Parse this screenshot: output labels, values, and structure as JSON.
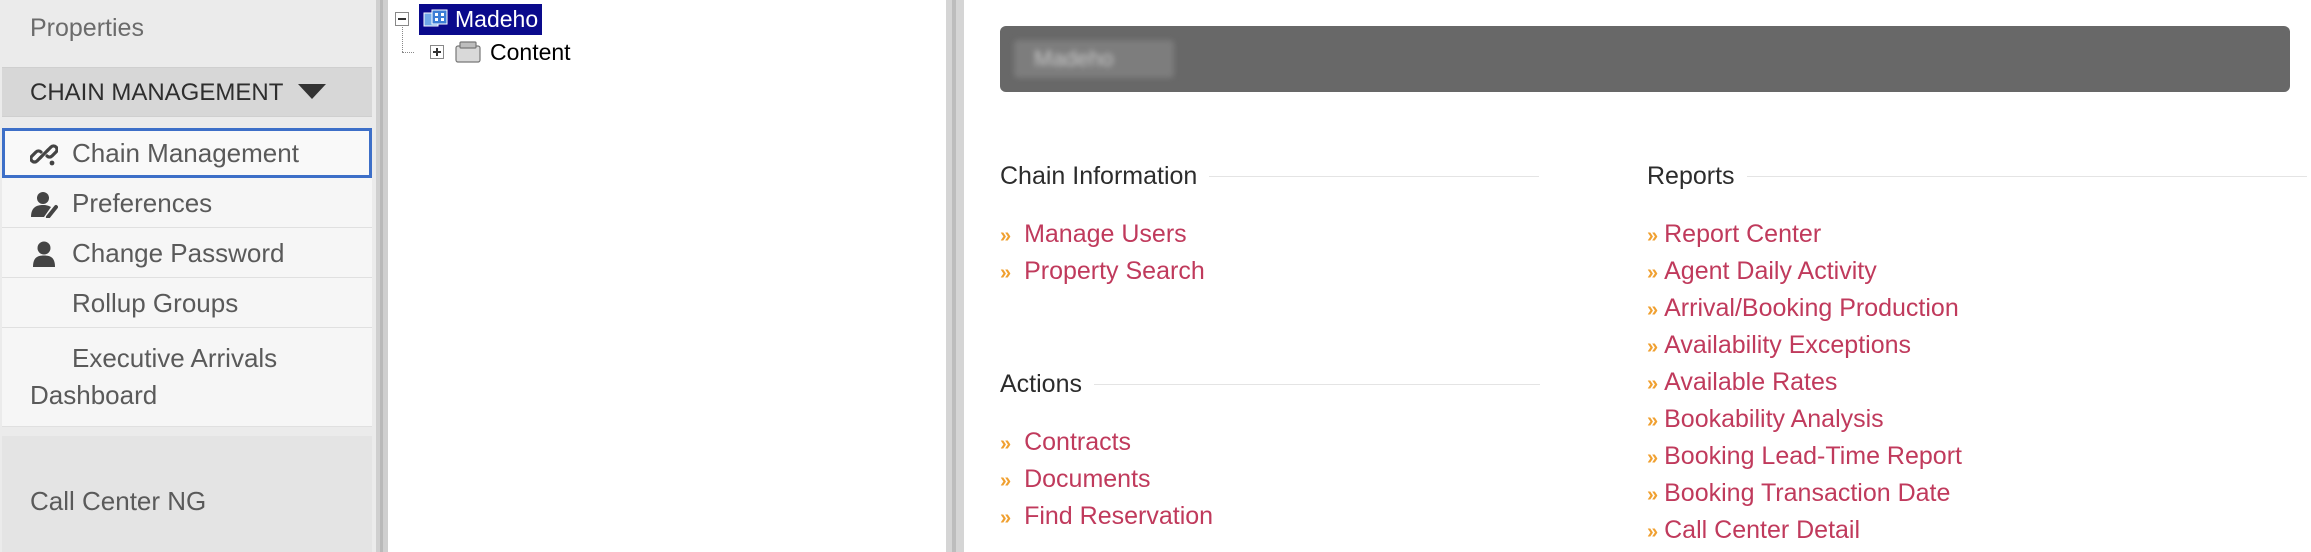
{
  "sidebar": {
    "top_label": "Properties",
    "section_header": "CHAIN MANAGEMENT",
    "items": [
      {
        "label": "Chain Management",
        "icon": "link-icon",
        "active": true
      },
      {
        "label": "Preferences",
        "icon": "user-settings-icon",
        "active": false
      },
      {
        "label": "Change Password",
        "icon": "user-icon",
        "active": false
      },
      {
        "label": "Rollup Groups",
        "icon": "",
        "active": false
      },
      {
        "label": "Executive Arrivals Dashboard",
        "icon": "",
        "active": false
      }
    ],
    "bottom_label": "Call Center NG"
  },
  "tree": {
    "root_label": "Madeho",
    "child_label": "Content"
  },
  "main": {
    "banner_text": "Madeho",
    "chain_info": {
      "title": "Chain Information",
      "links": [
        "Manage Users",
        "Property Search"
      ]
    },
    "actions": {
      "title": "Actions",
      "links": [
        "Contracts",
        "Documents",
        "Find Reservation"
      ]
    },
    "reports": {
      "title": "Reports",
      "links": [
        "Report Center",
        "Agent Daily Activity",
        "Arrival/Booking Production",
        "Availability Exceptions",
        "Available Rates",
        "Bookability Analysis",
        "Booking Lead-Time Report",
        "Booking Transaction Date",
        "Call Center Detail"
      ]
    },
    "bullet": "»"
  },
  "colors": {
    "link": "#c03a5c",
    "bullet": "#f0a030",
    "active_border": "#3d6fc8",
    "tree_selection": "#0a0a8c"
  }
}
